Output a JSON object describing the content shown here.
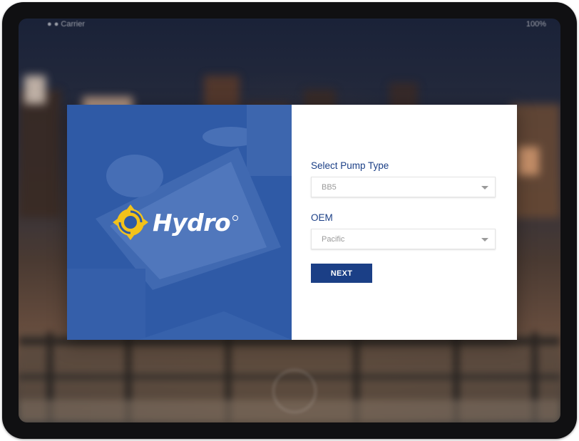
{
  "status_bar": {
    "left": "● ● Carrier",
    "right": "100%"
  },
  "brand": {
    "name": "Hydro",
    "logo_icon": "gear-icon",
    "logo_color": "#f2c21b",
    "panel_color": "#2f5aa6"
  },
  "form": {
    "pump_type_label": "Select Pump Type",
    "pump_type_value": "BB5",
    "oem_label": "OEM",
    "oem_value": "Pacific",
    "next_label": "NEXT",
    "accent_color": "#1b3f86"
  }
}
